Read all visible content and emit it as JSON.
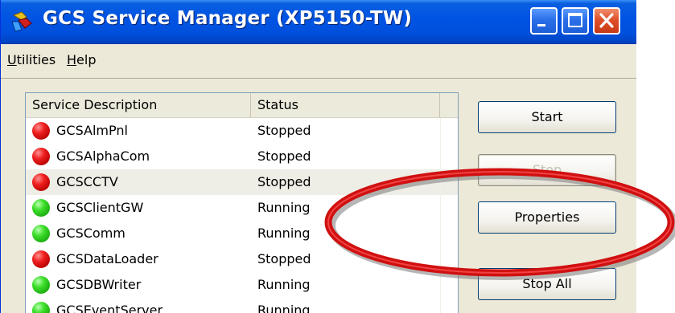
{
  "window": {
    "title": "GCS Service Manager (XP5150-TW)",
    "title_bar_color": "#0054e3"
  },
  "menu": {
    "items": [
      {
        "label": "Utilities"
      },
      {
        "label": "Help"
      }
    ]
  },
  "list": {
    "columns": [
      "Service Description",
      "Status"
    ],
    "rows": [
      {
        "name": "GCSAlmPnl",
        "status": "Stopped",
        "indicator": "red"
      },
      {
        "name": "GCSAlphaCom",
        "status": "Stopped",
        "indicator": "red"
      },
      {
        "name": "GCSCCTV",
        "status": "Stopped",
        "indicator": "red"
      },
      {
        "name": "GCSClientGW",
        "status": "Running",
        "indicator": "green"
      },
      {
        "name": "GCSComm",
        "status": "Running",
        "indicator": "green"
      },
      {
        "name": "GCSDataLoader",
        "status": "Stopped",
        "indicator": "red"
      },
      {
        "name": "GCSDBWriter",
        "status": "Running",
        "indicator": "green"
      },
      {
        "name": "GCSEventServer",
        "status": "Running",
        "indicator": "green"
      }
    ],
    "selected_row": "GCSCCTV"
  },
  "buttons": {
    "start": "Start",
    "stop": "Stop",
    "properties": "Properties",
    "stop_all": "Stop All"
  },
  "annotation": {
    "highlight_color": "#d01010"
  },
  "icons": {
    "app": "gcs-app-icon",
    "minimize": "minimize-icon",
    "maximize": "maximize-icon",
    "close": "close-icon",
    "stopped": "red-status-dot-icon",
    "running": "green-status-dot-icon"
  }
}
